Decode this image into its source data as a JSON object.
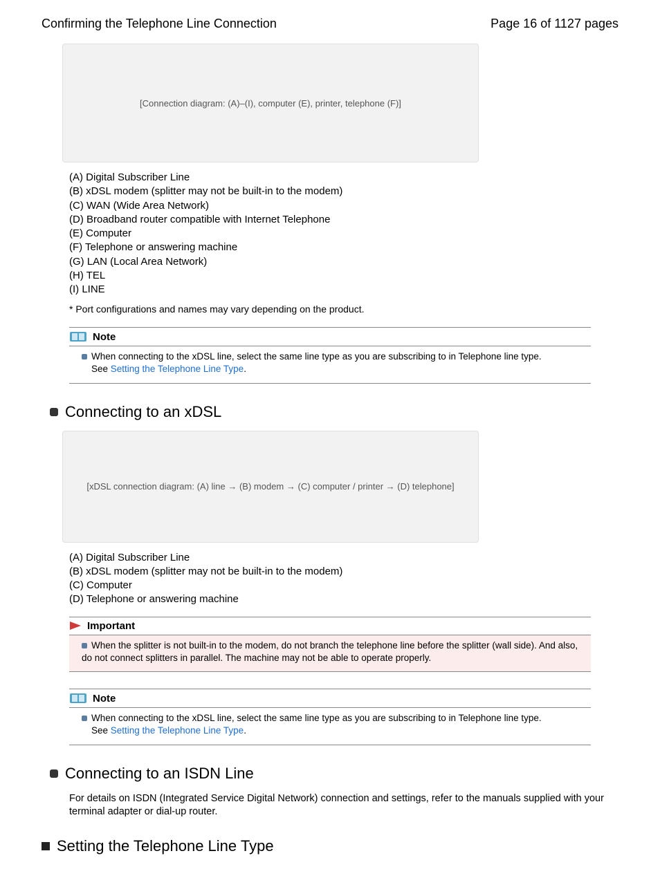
{
  "header": {
    "title": "Confirming the Telephone Line Connection",
    "page_label": "Page 16 of 1127 pages"
  },
  "diagram1": {
    "placeholder": "[Connection diagram: (A)–(I), computer (E), printer, telephone (F)]",
    "legend": {
      "a": "(A) Digital Subscriber Line",
      "b": "(B) xDSL modem (splitter may not be built-in to the modem)",
      "c": "(C) WAN (Wide Area Network)",
      "d": "(D) Broadband router compatible with Internet Telephone",
      "e": "(E) Computer",
      "f": "(F) Telephone or answering machine",
      "g": "(G) LAN (Local Area Network)",
      "h": "(H) TEL",
      "i": "(I) LINE"
    },
    "footnote": "* Port configurations and names may vary depending on the product."
  },
  "note1": {
    "heading": "Note",
    "body_line1": "When connecting to the xDSL line, select the same line type as you are subscribing to in Telephone line type.",
    "body_see": "See ",
    "body_link": "Setting the Telephone Line Type",
    "body_period": "."
  },
  "sec_xdsl": {
    "title": "Connecting to an xDSL"
  },
  "diagram2": {
    "placeholder": "[xDSL connection diagram: (A) line → (B) modem → (C) computer / printer → (D) telephone]",
    "legend": {
      "a": "(A) Digital Subscriber Line",
      "b": "(B) xDSL modem (splitter may not be built-in to the modem)",
      "c": "(C) Computer",
      "d": "(D) Telephone or answering machine"
    }
  },
  "important1": {
    "heading": "Important",
    "body": "When the splitter is not built-in to the modem, do not branch the telephone line before the splitter (wall side). And also, do not connect splitters in parallel. The machine may not be able to operate properly."
  },
  "note2": {
    "heading": "Note",
    "body_line1": "When connecting to the xDSL line, select the same line type as you are subscribing to in Telephone line type.",
    "body_see": "See ",
    "body_link": "Setting the Telephone Line Type",
    "body_period": "."
  },
  "sec_isdn": {
    "title": "Connecting to an ISDN Line",
    "body": "For details on ISDN (Integrated Service Digital Network) connection and settings, refer to the manuals supplied with your terminal adapter or dial-up router."
  },
  "sec_settype": {
    "title": "Setting the Telephone Line Type"
  }
}
